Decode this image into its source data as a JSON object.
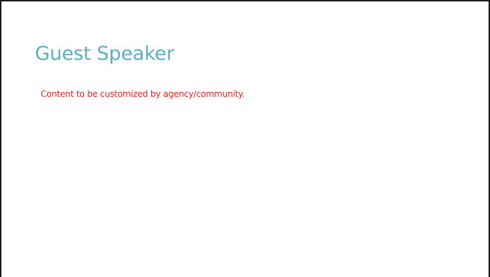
{
  "slide": {
    "title": "Guest Speaker",
    "body_text": "Content to be customized by agency/community."
  },
  "colors": {
    "title": "#5aafc0",
    "body_text": "#ee2222",
    "border": "#1a1a1a",
    "background": "#ffffff"
  }
}
